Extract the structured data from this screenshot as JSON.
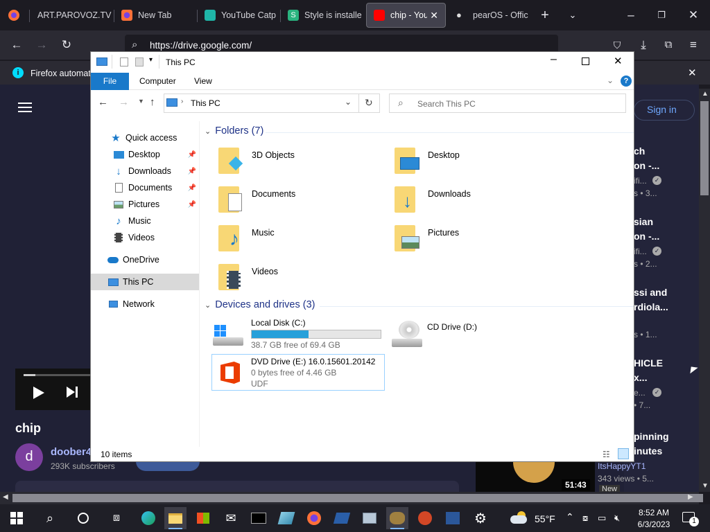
{
  "browser": {
    "tabs": [
      {
        "label": "ART.PAROVOZ.TV",
        "active": false
      },
      {
        "label": "New Tab",
        "active": false
      },
      {
        "label": "YouTube Catp",
        "active": false
      },
      {
        "label": "Style is installe",
        "active": false
      },
      {
        "label": "chip - YouT",
        "active": true
      },
      {
        "label": "pearOS - Offic",
        "active": false
      }
    ],
    "url": "https://drive.google.com/",
    "notification": "Firefox automat"
  },
  "youtube": {
    "video_title": "chip",
    "channel_initial": "d",
    "channel_name": "doober4",
    "subscribers": "293K subscribers",
    "sign_in": "Sign in",
    "duration": "51:43",
    "sidebar": [
      {
        "line1": "ch",
        "line2": "on -...",
        "meta1": "ifi...",
        "meta2": "s • 3..."
      },
      {
        "line1": "sian",
        "line2": "on -...",
        "meta1": "ifi...",
        "meta2": "s • 2..."
      },
      {
        "line1": "ssi and",
        "line2": "rdiola...",
        "meta1": "",
        "meta2": "s • 1..."
      },
      {
        "line1": "HICLE",
        "line2": "x...",
        "meta1": "e...",
        "meta2": "• 7..."
      },
      {
        "line1": "pinning",
        "line2": "inutes",
        "meta1": "ItsHappyYT1",
        "meta2": "343 views • 5..."
      }
    ],
    "new_badge": "New"
  },
  "explorer": {
    "title": "This PC",
    "ribbon_tabs": [
      "File",
      "Computer",
      "View"
    ],
    "address": "This PC",
    "search_placeholder": "Search This PC",
    "nav": {
      "quick_access": "Quick access",
      "items": [
        "Desktop",
        "Downloads",
        "Documents",
        "Pictures",
        "Music",
        "Videos"
      ],
      "onedrive": "OneDrive",
      "this_pc": "This PC",
      "network": "Network"
    },
    "folders_header": "Folders (7)",
    "folders": [
      "3D Objects",
      "Desktop",
      "Documents",
      "Downloads",
      "Music",
      "Pictures",
      "Videos"
    ],
    "drives_header": "Devices and drives (3)",
    "drives": [
      {
        "name": "Local Disk (C:)",
        "free": "38.7 GB free of 69.4 GB",
        "used_fraction": 0.44
      },
      {
        "name": "CD Drive (D:)"
      },
      {
        "name": "DVD Drive (E:) 16.0.15601.20142",
        "free": "0 bytes free of 4.46 GB",
        "fs": "UDF"
      }
    ],
    "status": "10 items"
  },
  "taskbar": {
    "weather": "55°F",
    "time": "8:52 AM",
    "date": "6/3/2023",
    "notif_count": "1"
  },
  "colors": {
    "accent": "#1979ca",
    "drive_bar": "#26a0da",
    "folder": "#f8d775"
  }
}
